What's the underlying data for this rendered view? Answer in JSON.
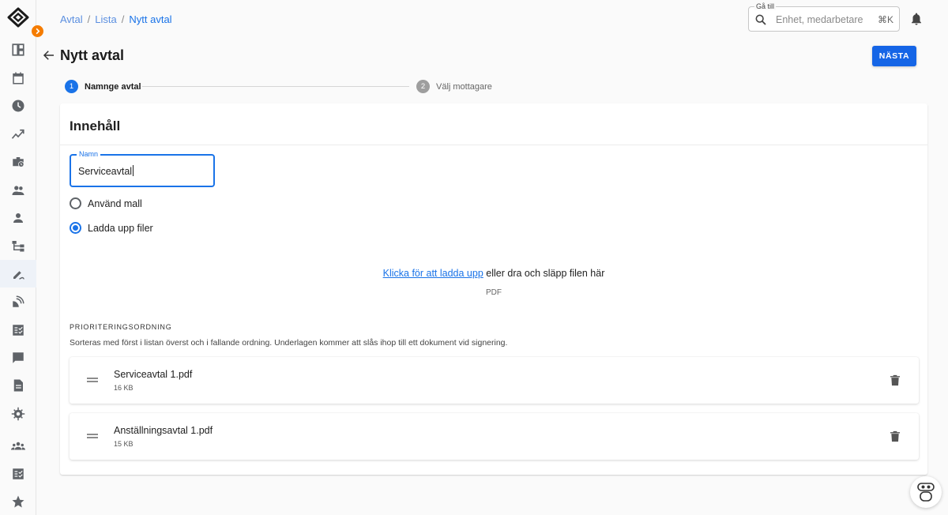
{
  "breadcrumb": {
    "item1": "Avtal",
    "item2": "Lista",
    "current": "Nytt avtal",
    "separator": "/"
  },
  "search": {
    "legend": "Gå till",
    "placeholder": "Enhet, medarbetare",
    "shortcut": "⌘K"
  },
  "page": {
    "title": "Nytt avtal",
    "next_label": "NÄSTA"
  },
  "stepper": [
    {
      "number": "1",
      "label": "Namnge avtal",
      "active": true
    },
    {
      "number": "2",
      "label": "Välj mottagare",
      "active": false
    }
  ],
  "card": {
    "title": "Innehåll",
    "name_field": {
      "label": "Namn",
      "value": "Serviceavtal"
    },
    "radio_options": [
      {
        "label": "Använd mall",
        "checked": false
      },
      {
        "label": "Ladda upp filer",
        "checked": true
      }
    ],
    "upload": {
      "link": "Klicka för att ladda upp",
      "rest": " eller dra och släpp filen här",
      "format": "PDF"
    },
    "priority": {
      "title": "PRIORITERINGSORDNING",
      "description": "Sorteras med först i listan överst och i fallande ordning. Underlagen kommer att slås ihop till ett dokument vid signering."
    },
    "files": [
      {
        "name": "Serviceavtal 1.pdf",
        "size": "16 KB"
      },
      {
        "name": "Anställningsavtal 1.pdf",
        "size": "15 KB"
      }
    ]
  },
  "sidebar": {
    "icons": [
      "dashboard-icon",
      "calendar-icon",
      "clock-icon",
      "trending-icon",
      "work-history-icon",
      "group-icon",
      "person-icon",
      "org-chart-icon",
      "signature-icon",
      "satellite-icon",
      "checklist-icon",
      "chat-icon",
      "document-icon",
      "settings-icon",
      "groups-icon",
      "task-list-icon",
      "star-icon"
    ],
    "active": "signature-icon"
  },
  "colors": {
    "primary": "#1a73e8",
    "button": "#1565e6",
    "expand": "#f57c00",
    "sidebar_active": "#eef2f8"
  }
}
